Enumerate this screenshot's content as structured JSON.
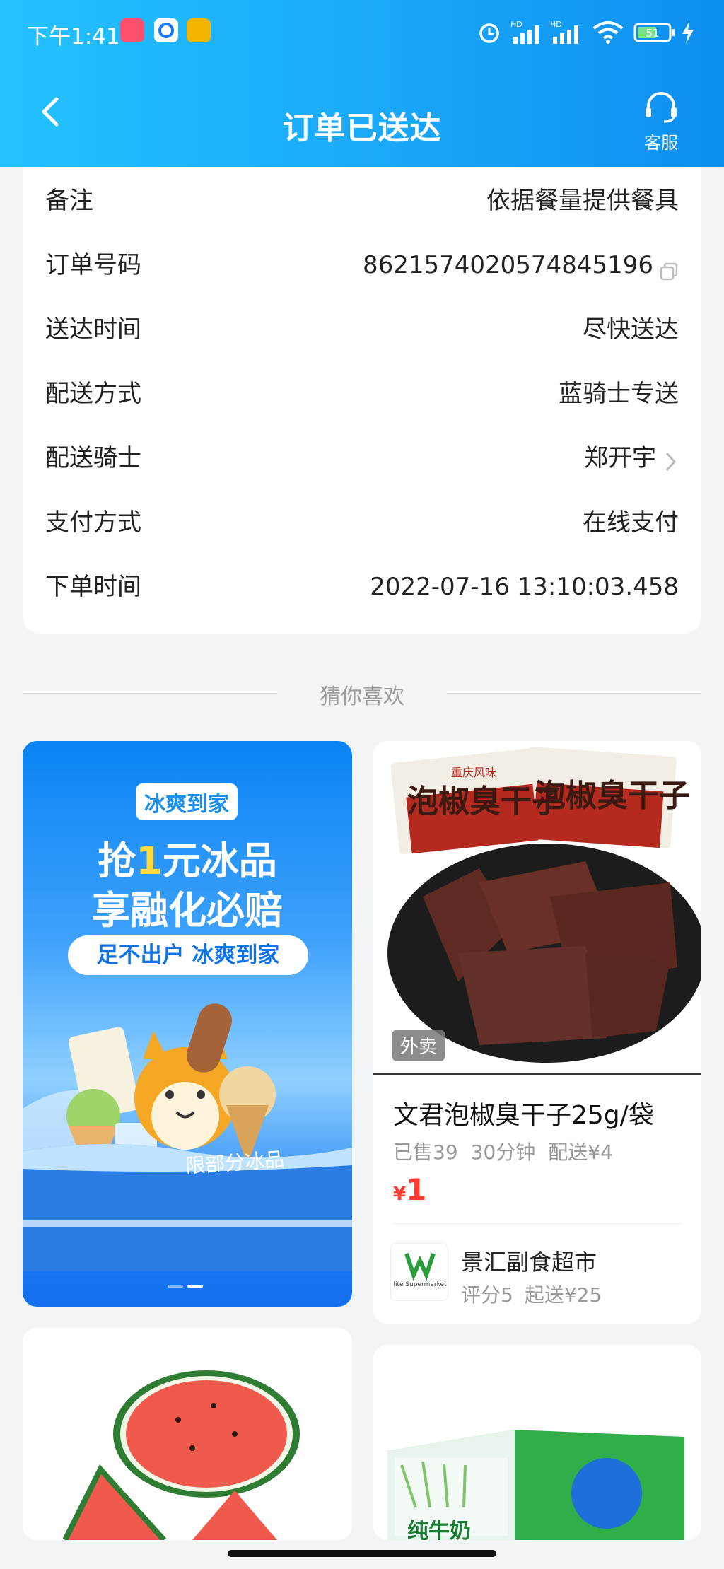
{
  "status_bar": {
    "time": "下午1:41",
    "battery": "51",
    "hd1": "HD",
    "hd2": "HD"
  },
  "header": {
    "title": "订单已送达",
    "service_label": "客服"
  },
  "order_info": {
    "rows": [
      {
        "label": "备注",
        "value": "依据餐量提供餐具"
      },
      {
        "label": "订单号码",
        "value": "8621574020574845196"
      },
      {
        "label": "送达时间",
        "value": "尽快送达"
      },
      {
        "label": "配送方式",
        "value": "蓝骑士专送"
      },
      {
        "label": "配送骑士",
        "value": "郑开宇"
      },
      {
        "label": "支付方式",
        "value": "在线支付"
      },
      {
        "label": "下单时间",
        "value": "2022-07-16 13:10:03.458"
      }
    ]
  },
  "recommend": {
    "section_title": "猜你喜欢",
    "banner": {
      "tag": "冰爽到家",
      "line1_a": "抢",
      "line1_num": "1",
      "line1_b": "元冰品",
      "line2": "享融化必赔",
      "pill": "足不出户 冰爽到家",
      "sub": "限部分冰品"
    },
    "product": {
      "image_label_1": "泡椒臭干子",
      "image_label_2": "重庆风味",
      "badge": "外卖",
      "name": "文君泡椒臭干子25g/袋",
      "sold": "已售39",
      "time": "30分钟",
      "delivery": "配送¥4",
      "currency": "¥",
      "price": "1",
      "shop_name": "景汇副食超市",
      "shop_rating": "评分5",
      "shop_min": "起送¥25",
      "shop_logo_text": "lite Supermarket"
    },
    "bottom_right_label": "纯牛奶"
  },
  "colors": {
    "header_start": "#23c2ff",
    "header_end": "#0d8ff0",
    "price": "#ff3b30",
    "banner": "#1570f0"
  }
}
